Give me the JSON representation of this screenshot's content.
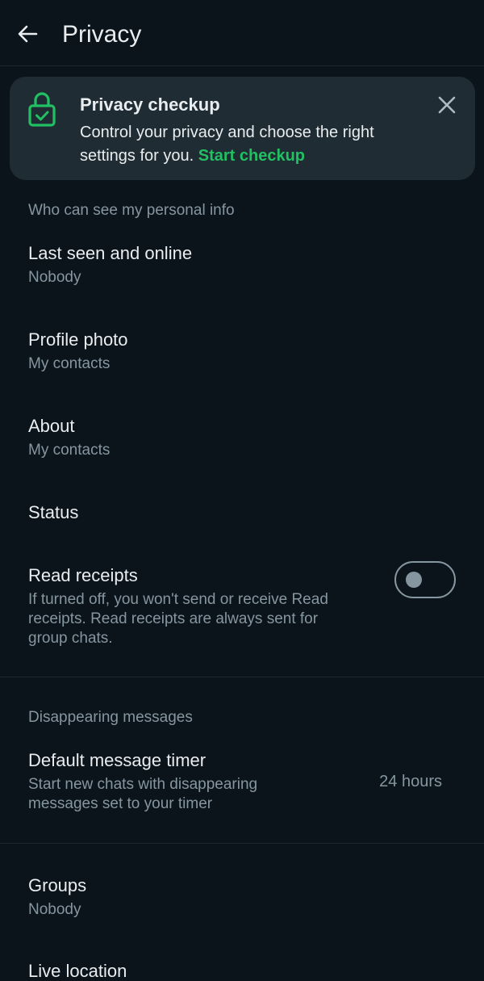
{
  "header": {
    "title": "Privacy",
    "back_icon": "arrow-left-icon"
  },
  "checkup": {
    "title": "Privacy checkup",
    "body": "Control your privacy and choose the right settings for you.",
    "link": "Start checkup",
    "lock_icon": "lock-check-icon",
    "close_icon": "close-icon",
    "accent_color": "#21c063"
  },
  "personal_info": {
    "header": "Who can see my personal info",
    "last_seen": {
      "title": "Last seen and online",
      "value": "Nobody"
    },
    "profile_photo": {
      "title": "Profile photo",
      "value": "My contacts"
    },
    "about": {
      "title": "About",
      "value": "My contacts"
    },
    "status": {
      "title": "Status"
    },
    "read_receipts": {
      "title": "Read receipts",
      "line1": "If turned off, you won't send or receive Read",
      "line2": "receipts. Read receipts are always sent for",
      "line3": "group chats.",
      "enabled": false
    }
  },
  "disappearing": {
    "header": "Disappearing messages",
    "timer": {
      "title": "Default message timer",
      "line1": "Start new chats with disappearing",
      "line2": "messages set to your timer",
      "value": "24 hours"
    }
  },
  "groups": {
    "title": "Groups",
    "value": "Nobody"
  },
  "live_location": {
    "title": "Live location"
  },
  "colors": {
    "background": "#0b141b",
    "card": "#1f2c33",
    "primary_text": "#e9edef",
    "secondary_text": "#8696a0",
    "accent": "#21c063"
  }
}
